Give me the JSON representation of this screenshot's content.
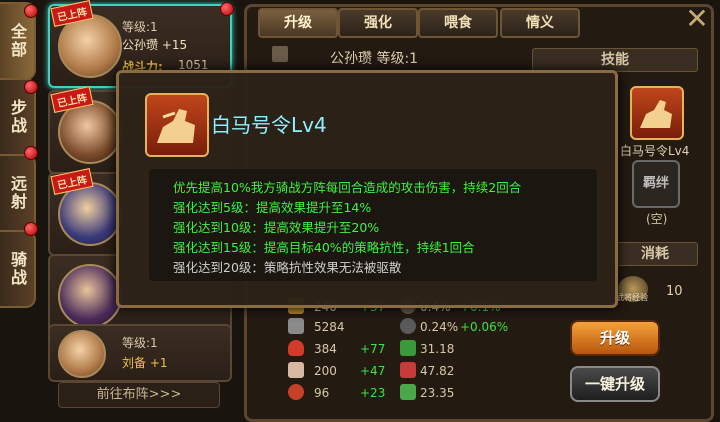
{
  "categories": [
    "全部",
    "步战",
    "远射",
    "骑战"
  ],
  "heroes": [
    {
      "deployed_label": "已上阵",
      "level": "等级:1",
      "name": "公孙瓒 +15",
      "power_label": "战斗力:",
      "power": "1051",
      "selected": true
    },
    {
      "deployed_label": "已上阵"
    },
    {
      "deployed_label": "已上阵"
    },
    {},
    {
      "level": "等级:1",
      "name": "刘备 +1"
    }
  ],
  "goto_formation": "前往布阵>>>",
  "tabs": [
    "升级",
    "强化",
    "喂食",
    "情义"
  ],
  "hero_header": "公孙瓒  等级:1",
  "right_panel": {
    "skill_header": "技能",
    "skill_name": "白马号令Lv4",
    "bond_label": "羁绊",
    "bond_value": "(空)",
    "consume_header": "消耗",
    "consume_item": "武将经验",
    "consume_value": "10"
  },
  "stats": [
    {
      "v1": "240",
      "g1": "+37",
      "v2": "0.4%",
      "g2": "+0.1%"
    },
    {
      "v1": "5284",
      "g1": "",
      "v2": "0.24%",
      "g2": "+0.06%"
    },
    {
      "v1": "384",
      "g1": "+77",
      "v2": "31.18",
      "g2": ""
    },
    {
      "v1": "200",
      "g1": "+47",
      "v2": "47.82",
      "g2": ""
    },
    {
      "v1": "96",
      "g1": "+23",
      "v2": "23.35",
      "g2": ""
    }
  ],
  "buttons": {
    "upgrade": "升级",
    "one_key_upgrade": "一键升级"
  },
  "popup": {
    "title": "白马号令Lv4",
    "lines": [
      {
        "text": "优先提高10%我方骑战方阵每回合造成的攻击伤害，持续2回合",
        "active": true
      },
      {
        "text": "强化达到5级：提高效果提升至14%",
        "active": true
      },
      {
        "text": "强化达到10级：提高效果提升至20%",
        "active": true
      },
      {
        "text": "强化达到15级：提高目标40%的策略抗性，持续1回合",
        "active": true
      },
      {
        "text": "强化达到20级：策略抗性效果无法被驱散",
        "active": false
      }
    ]
  },
  "colors": {
    "accent": "#3fd2c0",
    "active_text": "#3ff23f",
    "inactive_text": "#cfcfcf",
    "title": "#8ef0ff"
  }
}
